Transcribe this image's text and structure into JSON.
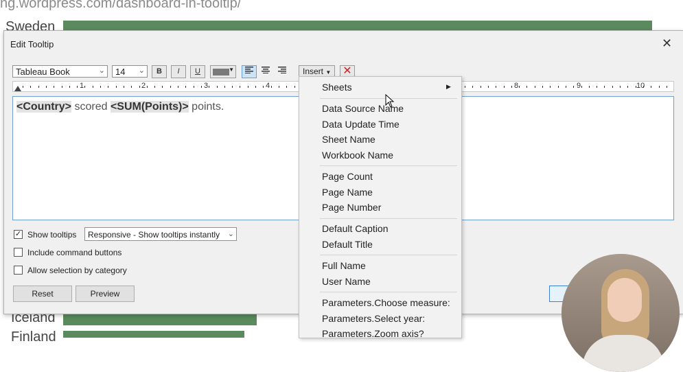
{
  "background": {
    "url_fragment": "ng.wordpress.com/dashboard-in-tooltip/",
    "rows": [
      {
        "label": "Sweden",
        "label_top": 26
      },
      {
        "label": "Iceland",
        "label_top": 451
      },
      {
        "label": "Finland",
        "label_top": 479
      }
    ],
    "bar_color": "#5b8a5e"
  },
  "dialog": {
    "title": "Edit Tooltip",
    "close_glyph": "✕",
    "font_family_value": "Tableau Book",
    "font_size_value": "14",
    "bold_label": "B",
    "italic_label": "I",
    "underline_label": "U",
    "text_color": "#7a7a7a",
    "insert_label": "Insert",
    "clear_glyph": "✕",
    "ruler_numbers": [
      "1",
      "2",
      "3",
      "4",
      "8",
      "9",
      "10"
    ],
    "editor": {
      "field_country": "<Country>",
      "text_scored": " scored ",
      "field_points": "<SUM(Points)>",
      "text_points": " points."
    },
    "show_tooltips_label": "Show tooltips",
    "show_tooltips_checked": true,
    "tooltip_mode_value": "Responsive - Show tooltips instantly",
    "include_command_buttons_label": "Include command buttons",
    "include_command_buttons_checked": false,
    "allow_selection_label": "Allow selection by category",
    "allow_selection_checked": false,
    "reset_label": "Reset",
    "preview_label": "Preview"
  },
  "insert_menu": {
    "sheets": "Sheets",
    "group1": [
      "Data Source Name",
      "Data Update Time",
      "Sheet Name",
      "Workbook Name"
    ],
    "group2": [
      "Page Count",
      "Page Name",
      "Page Number"
    ],
    "group3": [
      "Default Caption",
      "Default Title"
    ],
    "group4": [
      "Full Name",
      "User Name"
    ],
    "group5": [
      "Parameters.Choose measure:",
      "Parameters.Select year:",
      "Parameters.Zoom axis?"
    ]
  }
}
